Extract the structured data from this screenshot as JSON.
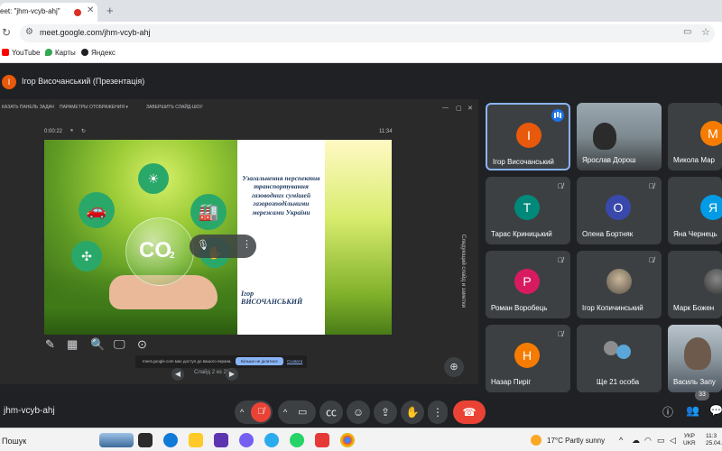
{
  "browser": {
    "tab_title": "eet: \"jhm-vcyb-ahj\"",
    "new_tab": "+",
    "url": "meet.google.com/jhm-vcyb-ahj",
    "bookmarks": [
      {
        "label": "YouTube",
        "color": "#ff0000"
      },
      {
        "label": "Карты",
        "color": "#34a853"
      },
      {
        "label": "Яндекс",
        "color": "#202124"
      }
    ]
  },
  "presentation": {
    "presenter_initial": "І",
    "title": "Ігор Височанський (Презентація)",
    "toolbar": {
      "taskbar_label": "КАЗАТЬ ПАНЕЛЬ ЗАДАЧ",
      "display_settings": "ПАРАМЕТРЫ ОТОБРАЖЕНИЯ ▾",
      "end_show": "ЗАВЕРШИТЬ СЛАЙД-ШОУ"
    },
    "timer": "0:00:22",
    "clock": "11:34",
    "side_label": "Следующий слайд и заметки",
    "slide_title": "Узагальнення перспектив транспортування газоводних сумішей газорозподільними мережами України",
    "author_first": "Ігор",
    "author_last": "ВИСОЧАНСЬКИЙ",
    "co2": "CO",
    "slide_counter": "Слайд 2 из 20",
    "notice": {
      "message": "meet.google.com має доступ до вашого екрана.",
      "stop": "Більше не ділитися",
      "hide": "Сховати"
    }
  },
  "participants": [
    {
      "name": "Ігор Височанський",
      "initial": "І",
      "color": "#e8590c",
      "active": true
    },
    {
      "name": "Ярослав Дорош",
      "initial": "",
      "color": "#6d6d6d",
      "video": true
    },
    {
      "name": "Микола Мар",
      "initial": "М",
      "color": "#f57c00"
    },
    {
      "name": "Тарас Криницький",
      "initial": "Т",
      "color": "#00897b"
    },
    {
      "name": "Олена Бортняк",
      "initial": "О",
      "color": "#3949ab"
    },
    {
      "name": "Яна Чернець",
      "initial": "Я",
      "color": "#039be5"
    },
    {
      "name": "Роман Воробець",
      "initial": "Р",
      "color": "#d81b60"
    },
    {
      "name": "Ігор Копичинський",
      "initial": "",
      "color": "#7b7b7b",
      "photo": true
    },
    {
      "name": "Марк Божен",
      "initial": "",
      "color": "#444444"
    },
    {
      "name": "Назар Пиріг",
      "initial": "Н",
      "color": "#f57c00"
    },
    {
      "name": "Ще 21 особа",
      "initial": "",
      "color": "#3c4043"
    },
    {
      "name": "Василь Запу",
      "initial": "",
      "color": "#5a6b7a",
      "video": true
    }
  ],
  "controls": {
    "meeting_code": "jhm-vcyb-ahj",
    "participant_count": "33"
  },
  "taskbar": {
    "search": "Пошук",
    "weather": "17°C  Partly sunny",
    "lang1": "УКР",
    "lang2": "UKR",
    "time": "11:3",
    "date": "25.04.2"
  }
}
